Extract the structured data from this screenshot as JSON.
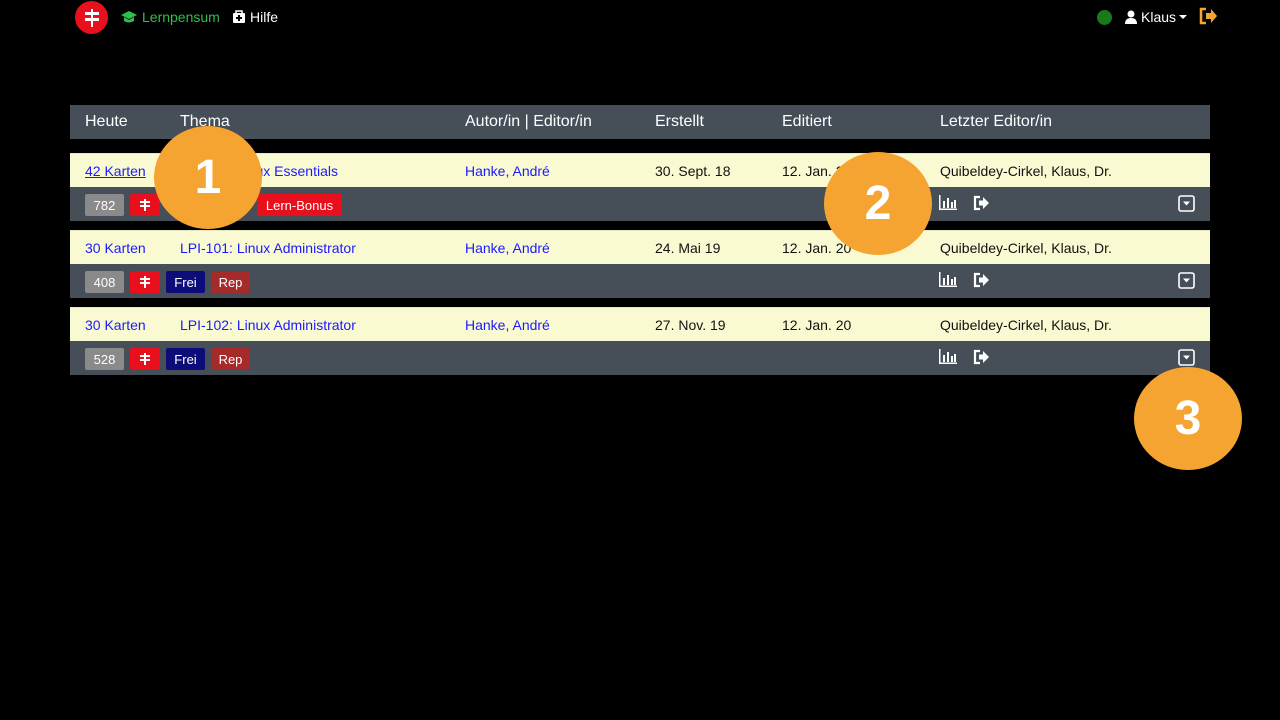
{
  "nav": {
    "lernpensum_label": "Lernpensum",
    "hilfe_label": "Hilfe",
    "user_label": "Klaus",
    "logo_icon": "signpost-icon",
    "status_color": "#1a7a1a",
    "accent_green": "#2fbf4f",
    "logout_color": "#f6a431"
  },
  "table": {
    "headers": {
      "heute": "Heute",
      "thema": "Thema",
      "autor": "Autor/in | Editor/in",
      "erstellt": "Erstellt",
      "editiert": "Editiert",
      "letzter": "Letzter Editor/in"
    },
    "rows": [
      {
        "heute": "42 Karten",
        "thema": "LPI-010: Linux Essentials",
        "thema_visible": "x Essentials",
        "autor": "Hanke, André",
        "erstellt": "30. Sept. 18",
        "editiert": "12. Jan. 2",
        "letzter": "Quibeldey-Cirkel, Klaus, Dr.",
        "count": "782",
        "bonus": "Lern-Bonus"
      },
      {
        "heute": "30 Karten",
        "thema": "LPI-101: Linux Administrator",
        "autor": "Hanke, André",
        "erstellt": "24. Mai 19",
        "editiert": "12. Jan. 20",
        "letzter": "Quibeldey-Cirkel, Klaus, Dr.",
        "count": "408",
        "frei": "Frei",
        "rep": "Rep"
      },
      {
        "heute": "30 Karten",
        "thema": "LPI-102: Linux Administrator",
        "autor": "Hanke, André",
        "erstellt": "27. Nov. 19",
        "editiert": "12. Jan. 20",
        "letzter": "Quibeldey-Cirkel, Klaus, Dr.",
        "count": "528",
        "frei": "Frei",
        "rep": "Rep"
      }
    ]
  },
  "callouts": [
    "1",
    "2",
    "3"
  ]
}
